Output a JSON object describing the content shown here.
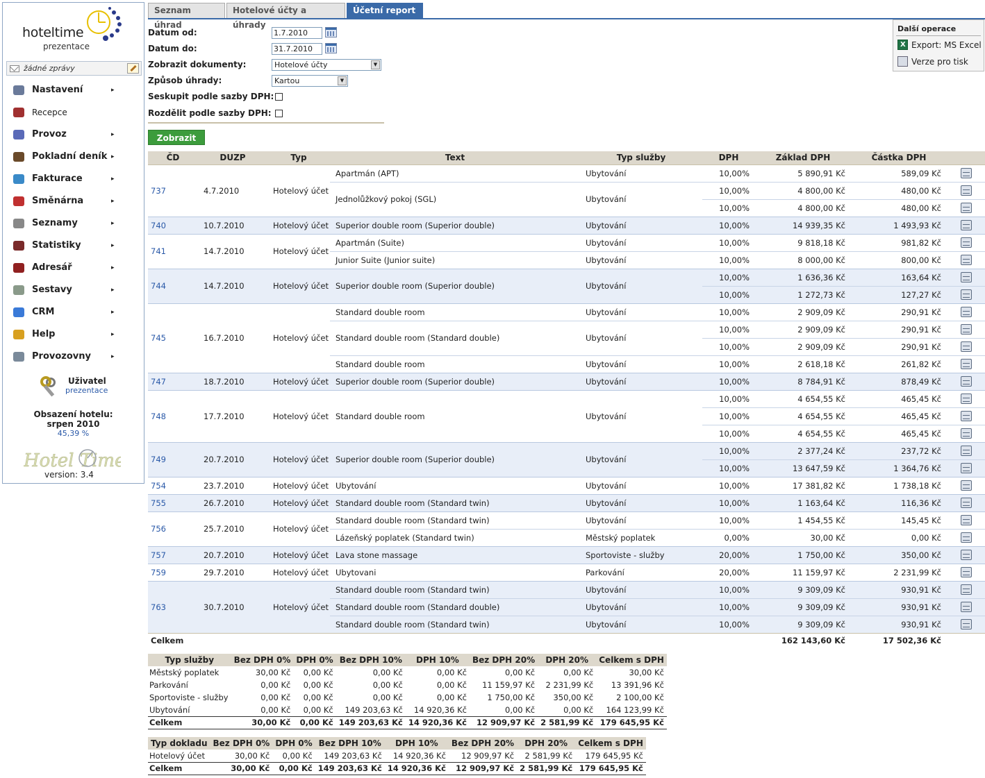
{
  "app": {
    "logo_text": "hoteltime",
    "logo_sub": "prezentace",
    "messages": "žádné zprávy",
    "menu": [
      {
        "label": "Nastavení",
        "arrow": "▸",
        "color": "#6a7a9a"
      },
      {
        "label": "Recepce",
        "arrow": "",
        "color": "#a03030"
      },
      {
        "label": "Provoz",
        "arrow": "▸",
        "color": "#5a6ab8"
      },
      {
        "label": "Pokladní deník",
        "arrow": "▸",
        "color": "#6a4a2a"
      },
      {
        "label": "Fakturace",
        "arrow": "▸",
        "color": "#3a8ac8"
      },
      {
        "label": "Směnárna",
        "arrow": "▸",
        "color": "#c03030"
      },
      {
        "label": "Seznamy",
        "arrow": "▸",
        "color": "#888888"
      },
      {
        "label": "Statistiky",
        "arrow": "▸",
        "color": "#7a2a2a"
      },
      {
        "label": "Adresář",
        "arrow": "▸",
        "color": "#902020"
      },
      {
        "label": "Sestavy",
        "arrow": "▸",
        "color": "#8a9a8a"
      },
      {
        "label": "CRM",
        "arrow": "▸",
        "color": "#3a7ad8"
      },
      {
        "label": "Help",
        "arrow": "▸",
        "color": "#d8a020"
      },
      {
        "label": "Provozovny",
        "arrow": "▸",
        "color": "#7a8a9a"
      }
    ],
    "user_label": "Uživatel",
    "user_name": "prezentace",
    "occupancy_label": "Obsazení hotelu:",
    "occupancy_month": "srpen 2010",
    "occupancy_value": "45,39 %",
    "version": "version: 3.4"
  },
  "tabs": [
    "Seznam úhrad",
    "Hotelové účty a úhrady",
    "Účetní report"
  ],
  "form": {
    "date_from_label": "Datum od:",
    "date_from": "1.7.2010",
    "date_to_label": "Datum do:",
    "date_to": "31.7.2010",
    "docs_label": "Zobrazit dokumenty:",
    "docs_value": "Hotelové účty",
    "pay_label": "Způsob úhrady:",
    "pay_value": "Kartou",
    "group_label": "Seskupit podle sazby DPH:",
    "split_label": "Rozdělit podle sazby DPH:",
    "show_button": "Zobrazit"
  },
  "ops": {
    "title": "Další operace",
    "export": "Export: MS Excel",
    "print": "Verze pro tisk"
  },
  "table": {
    "headers": [
      "ČD",
      "DUZP",
      "Typ",
      "Text",
      "Typ služby",
      "DPH",
      "Základ DPH",
      "Částka DPH"
    ],
    "groups": [
      {
        "cd": "737",
        "duzp": "4.7.2010",
        "typ": "Hotelový účet",
        "rows": [
          {
            "text": "Apartmán (APT)",
            "svc": "Ubytování",
            "dph": "10,00%",
            "zaklad": "5 890,91 Kč",
            "castka": "589,09 Kč"
          },
          {
            "text": "Jednolůžkový pokoj (SGL)",
            "svc": "Ubytování",
            "dph": "10,00%",
            "zaklad": "4 800,00 Kč",
            "castka": "480,00 Kč"
          },
          {
            "text": "",
            "svc": "",
            "dph": "10,00%",
            "zaklad": "4 800,00 Kč",
            "castka": "480,00 Kč"
          }
        ]
      },
      {
        "cd": "740",
        "duzp": "10.7.2010",
        "typ": "Hotelový účet",
        "rows": [
          {
            "text": "Superior double room (Superior double)",
            "svc": "Ubytování",
            "dph": "10,00%",
            "zaklad": "14 939,35 Kč",
            "castka": "1 493,93 Kč"
          }
        ]
      },
      {
        "cd": "741",
        "duzp": "14.7.2010",
        "typ": "Hotelový účet",
        "rows": [
          {
            "text": "Apartmán (Suite)",
            "svc": "Ubytování",
            "dph": "10,00%",
            "zaklad": "9 818,18 Kč",
            "castka": "981,82 Kč"
          },
          {
            "text": "Junior Suite (Junior suite)",
            "svc": "Ubytování",
            "dph": "10,00%",
            "zaklad": "8 000,00 Kč",
            "castka": "800,00 Kč"
          }
        ]
      },
      {
        "cd": "744",
        "duzp": "14.7.2010",
        "typ": "Hotelový účet",
        "rows": [
          {
            "text": "Superior double room (Superior double)",
            "svc": "Ubytování",
            "dph": "10,00%",
            "zaklad": "1 636,36 Kč",
            "castka": "163,64 Kč"
          },
          {
            "text": "",
            "svc": "",
            "dph": "10,00%",
            "zaklad": "1 272,73 Kč",
            "castka": "127,27 Kč"
          }
        ]
      },
      {
        "cd": "745",
        "duzp": "16.7.2010",
        "typ": "Hotelový účet",
        "rows": [
          {
            "text": "Standard double room",
            "svc": "Ubytování",
            "dph": "10,00%",
            "zaklad": "2 909,09 Kč",
            "castka": "290,91 Kč"
          },
          {
            "text": "Standard double room (Standard double)",
            "svc": "Ubytování",
            "dph": "10,00%",
            "zaklad": "2 909,09 Kč",
            "castka": "290,91 Kč"
          },
          {
            "text": "",
            "svc": "",
            "dph": "10,00%",
            "zaklad": "2 909,09 Kč",
            "castka": "290,91 Kč"
          },
          {
            "text": "Standard double room",
            "svc": "Ubytování",
            "dph": "10,00%",
            "zaklad": "2 618,18 Kč",
            "castka": "261,82 Kč"
          }
        ]
      },
      {
        "cd": "747",
        "duzp": "18.7.2010",
        "typ": "Hotelový účet",
        "rows": [
          {
            "text": "Superior double room (Superior double)",
            "svc": "Ubytování",
            "dph": "10,00%",
            "zaklad": "8 784,91 Kč",
            "castka": "878,49 Kč"
          }
        ]
      },
      {
        "cd": "748",
        "duzp": "17.7.2010",
        "typ": "Hotelový účet",
        "rows": [
          {
            "text": "Standard double room",
            "svc": "Ubytování",
            "dph": "10,00%",
            "zaklad": "4 654,55 Kč",
            "castka": "465,45 Kč"
          },
          {
            "text": "",
            "svc": "",
            "dph": "10,00%",
            "zaklad": "4 654,55 Kč",
            "castka": "465,45 Kč"
          },
          {
            "text": "",
            "svc": "",
            "dph": "10,00%",
            "zaklad": "4 654,55 Kč",
            "castka": "465,45 Kč"
          }
        ]
      },
      {
        "cd": "749",
        "duzp": "20.7.2010",
        "typ": "Hotelový účet",
        "rows": [
          {
            "text": "Superior double room (Superior double)",
            "svc": "Ubytování",
            "dph": "10,00%",
            "zaklad": "2 377,24 Kč",
            "castka": "237,72 Kč"
          },
          {
            "text": "",
            "svc": "",
            "dph": "10,00%",
            "zaklad": "13 647,59 Kč",
            "castka": "1 364,76 Kč"
          }
        ]
      },
      {
        "cd": "754",
        "duzp": "23.7.2010",
        "typ": "Hotelový účet",
        "rows": [
          {
            "text": "Ubytování",
            "svc": "Ubytování",
            "dph": "10,00%",
            "zaklad": "17 381,82 Kč",
            "castka": "1 738,18 Kč"
          }
        ]
      },
      {
        "cd": "755",
        "duzp": "26.7.2010",
        "typ": "Hotelový účet",
        "rows": [
          {
            "text": "Standard double room (Standard twin)",
            "svc": "Ubytování",
            "dph": "10,00%",
            "zaklad": "1 163,64 Kč",
            "castka": "116,36 Kč"
          }
        ]
      },
      {
        "cd": "756",
        "duzp": "25.7.2010",
        "typ": "Hotelový účet",
        "rows": [
          {
            "text": "Standard double room (Standard twin)",
            "svc": "Ubytování",
            "dph": "10,00%",
            "zaklad": "1 454,55 Kč",
            "castka": "145,45 Kč"
          },
          {
            "text": "Lázeňský poplatek (Standard twin)",
            "svc": "Městský poplatek",
            "dph": "0,00%",
            "zaklad": "30,00 Kč",
            "castka": "0,00 Kč"
          }
        ]
      },
      {
        "cd": "757",
        "duzp": "20.7.2010",
        "typ": "Hotelový účet",
        "rows": [
          {
            "text": "Lava stone massage",
            "svc": "Sportoviste - služby",
            "dph": "20,00%",
            "zaklad": "1 750,00 Kč",
            "castka": "350,00 Kč"
          }
        ]
      },
      {
        "cd": "759",
        "duzp": "29.7.2010",
        "typ": "Hotelový účet",
        "rows": [
          {
            "text": "Ubytovani",
            "svc": "Parkování",
            "dph": "20,00%",
            "zaklad": "11 159,97 Kč",
            "castka": "2 231,99 Kč"
          }
        ]
      },
      {
        "cd": "763",
        "duzp": "30.7.2010",
        "typ": "Hotelový účet",
        "rows": [
          {
            "text": "Standard double room (Standard twin)",
            "svc": "Ubytování",
            "dph": "10,00%",
            "zaklad": "9 309,09 Kč",
            "castka": "930,91 Kč"
          },
          {
            "text": "Standard double room (Standard double)",
            "svc": "Ubytování",
            "dph": "10,00%",
            "zaklad": "9 309,09 Kč",
            "castka": "930,91 Kč"
          },
          {
            "text": "Standard double room (Standard twin)",
            "svc": "Ubytování",
            "dph": "10,00%",
            "zaklad": "9 309,09 Kč",
            "castka": "930,91 Kč"
          }
        ]
      }
    ],
    "total_label": "Celkem",
    "total_zaklad": "162 143,60 Kč",
    "total_castka": "17 502,36 Kč"
  },
  "sum1": {
    "headers": [
      "Typ služby",
      "Bez DPH 0%",
      "DPH 0%",
      "Bez DPH 10%",
      "DPH 10%",
      "Bez DPH 20%",
      "DPH 20%",
      "Celkem s DPH"
    ],
    "rows": [
      [
        "Městský poplatek",
        "30,00 Kč",
        "0,00 Kč",
        "0,00 Kč",
        "0,00 Kč",
        "0,00 Kč",
        "0,00 Kč",
        "30,00 Kč"
      ],
      [
        "Parkování",
        "0,00 Kč",
        "0,00 Kč",
        "0,00 Kč",
        "0,00 Kč",
        "11 159,97 Kč",
        "2 231,99 Kč",
        "13 391,96 Kč"
      ],
      [
        "Sportoviste - služby",
        "0,00 Kč",
        "0,00 Kč",
        "0,00 Kč",
        "0,00 Kč",
        "1 750,00 Kč",
        "350,00 Kč",
        "2 100,00 Kč"
      ],
      [
        "Ubytování",
        "0,00 Kč",
        "0,00 Kč",
        "149 203,63 Kč",
        "14 920,36 Kč",
        "0,00 Kč",
        "0,00 Kč",
        "164 123,99 Kč"
      ]
    ],
    "total": [
      "Celkem",
      "30,00 Kč",
      "0,00 Kč",
      "149 203,63 Kč",
      "14 920,36 Kč",
      "12 909,97 Kč",
      "2 581,99 Kč",
      "179 645,95 Kč"
    ]
  },
  "sum2": {
    "headers": [
      "Typ dokladu",
      "Bez DPH 0%",
      "DPH 0%",
      "Bez DPH 10%",
      "DPH 10%",
      "Bez DPH 20%",
      "DPH 20%",
      "Celkem s DPH"
    ],
    "rows": [
      [
        "Hotelový účet",
        "30,00 Kč",
        "0,00 Kč",
        "149 203,63 Kč",
        "14 920,36 Kč",
        "12 909,97 Kč",
        "2 581,99 Kč",
        "179 645,95 Kč"
      ]
    ],
    "total": [
      "Celkem",
      "30,00 Kč",
      "0,00 Kč",
      "149 203,63 Kč",
      "14 920,36 Kč",
      "12 909,97 Kč",
      "2 581,99 Kč",
      "179 645,95 Kč"
    ]
  }
}
